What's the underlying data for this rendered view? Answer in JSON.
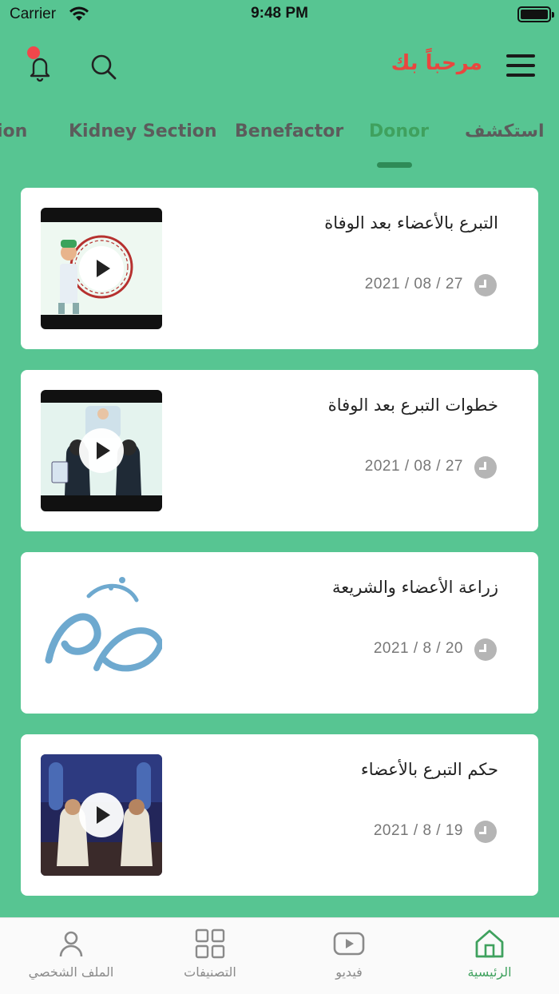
{
  "status_bar": {
    "carrier": "Carrier",
    "time": "9:48 PM"
  },
  "header": {
    "welcome": "مرحباً بك"
  },
  "tabs": [
    {
      "label": "ion",
      "active": false
    },
    {
      "label": "Kidney Section",
      "active": false
    },
    {
      "label": "Benefactor",
      "active": false
    },
    {
      "label": "Donor",
      "active": true
    },
    {
      "label": "استكشف",
      "active": false
    }
  ],
  "cards": [
    {
      "title": "التبرع بالأعضاء بعد الوفاة",
      "date": "2021 / 08 / 27",
      "thumb": "doctor-video"
    },
    {
      "title": "خطوات التبرع بعد الوفاة",
      "date": "2021 / 08 / 27",
      "thumb": "doctors-video"
    },
    {
      "title": "زراعة الأعضاء والشريعة",
      "date": "2021 / 8 / 20",
      "thumb": "fatwa-calligraphy"
    },
    {
      "title": "حكم التبرع بالأعضاء",
      "date": "2021 / 8 / 19",
      "thumb": "studio-video"
    }
  ],
  "bottom_nav": [
    {
      "label": "الملف الشخصي",
      "icon": "profile-icon",
      "active": false
    },
    {
      "label": "التصنيفات",
      "icon": "categories-icon",
      "active": false
    },
    {
      "label": "فيديو",
      "icon": "video-icon",
      "active": false
    },
    {
      "label": "الرئيسية",
      "icon": "home-icon",
      "active": true
    }
  ],
  "colors": {
    "background": "#57c592",
    "accent_green": "#3fa15e",
    "welcome_red": "#e9463f"
  }
}
